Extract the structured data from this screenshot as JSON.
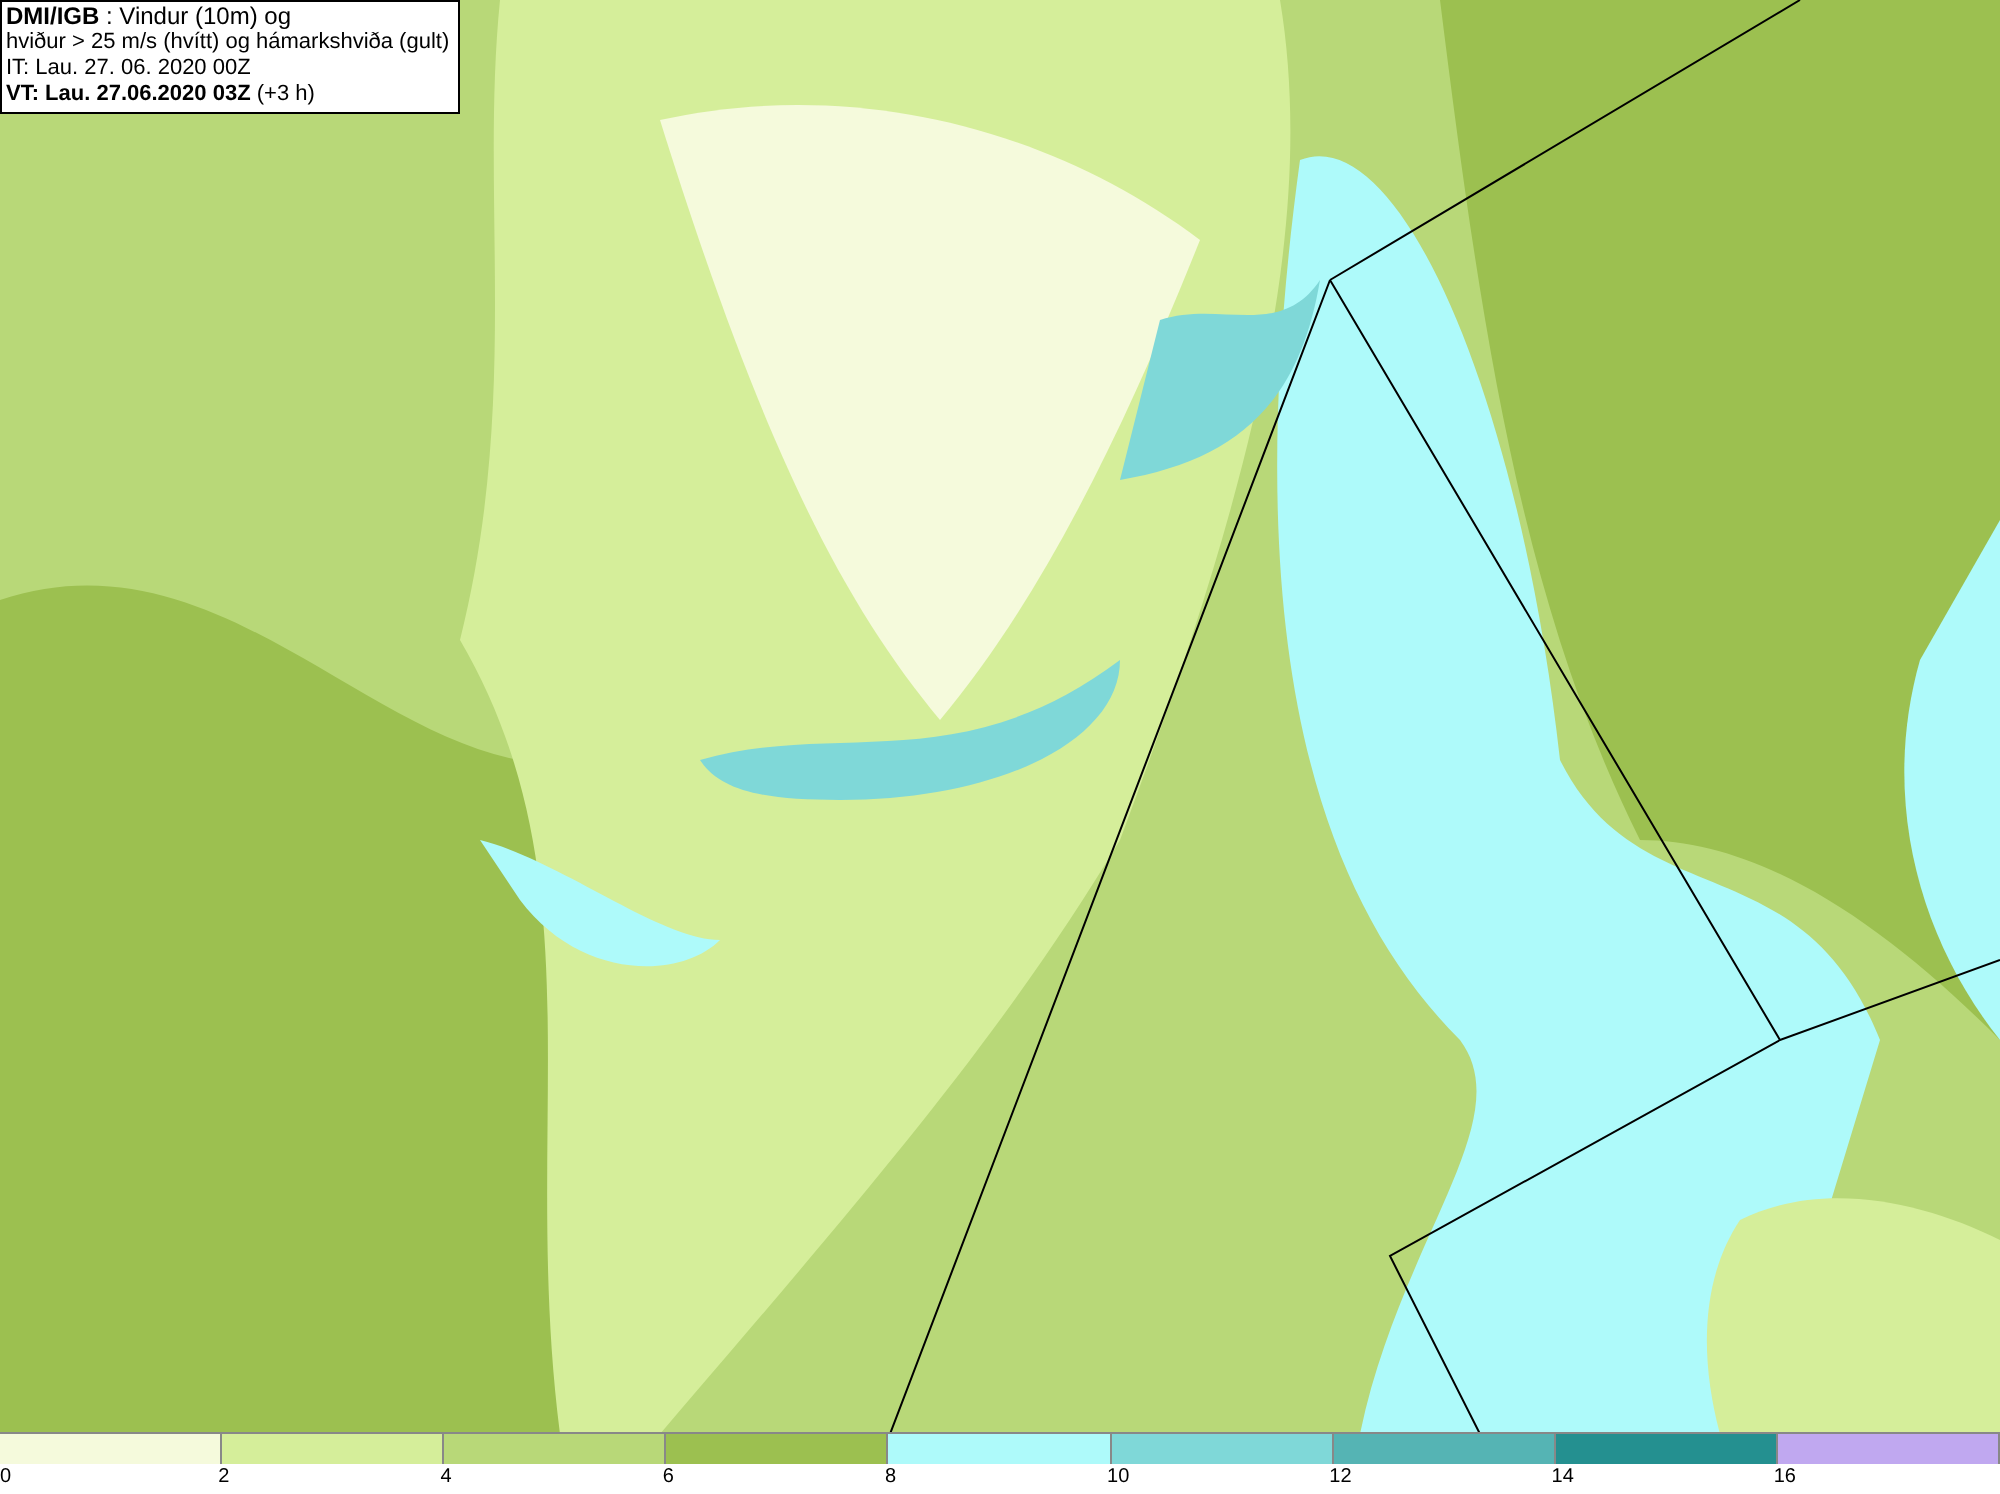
{
  "title_box": {
    "lines": [
      "**DMI/IGB** : Vindur (10m) og",
      "hviður > 25 m/s (hvítt) og hámarkshviða (gult)",
      "IT: Lau. 27. 06. 2020 00Z",
      "**VT: Lau. 27.06.2020 03Z** (+3 h)"
    ]
  },
  "legend": {
    "bins": [
      {
        "label": "0",
        "color": "#f5fadc"
      },
      {
        "label": "2",
        "color": "#d5ee9a"
      },
      {
        "label": "4",
        "color": "#b8d878"
      },
      {
        "label": "6",
        "color": "#9cc050"
      },
      {
        "label": "8",
        "color": "#aefafa"
      },
      {
        "label": "10",
        "color": "#7fd8d8"
      },
      {
        "label": "12",
        "color": "#55b4b4"
      },
      {
        "label": "14",
        "color": "#249090"
      },
      {
        "label": "16",
        "color": "#c0a8f0"
      }
    ]
  }
}
